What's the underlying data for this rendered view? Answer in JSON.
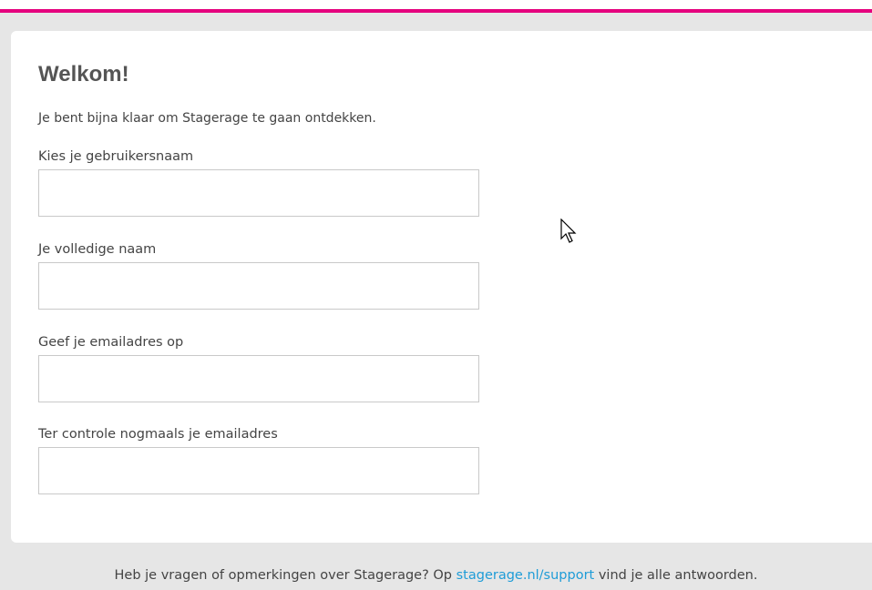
{
  "colors": {
    "accent": "#e5007e",
    "link": "#1e9cd7"
  },
  "title": "Welkom!",
  "intro": "Je bent bijna klaar om Stagerage te gaan ontdekken.",
  "form": {
    "username": {
      "label": "Kies je gebruikersnaam",
      "value": ""
    },
    "fullname": {
      "label": "Je volledige naam",
      "value": ""
    },
    "email": {
      "label": "Geef je emailadres op",
      "value": ""
    },
    "email_confirm": {
      "label": "Ter controle nogmaals je emailadres",
      "value": ""
    }
  },
  "footer": {
    "text_before": "Heb je vragen of opmerkingen over Stagerage? Op",
    "link": "stagerage.nl/support",
    "text_after": "vind je alle antwoorden."
  },
  "cursor": {
    "icon": "mouse-pointer-icon"
  }
}
